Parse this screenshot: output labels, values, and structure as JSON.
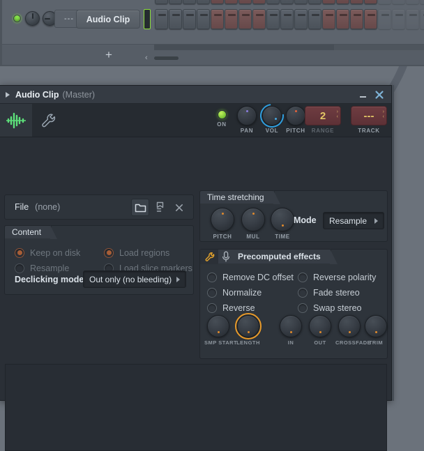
{
  "channel_rack": {
    "channel_name": "Audio Clip",
    "value_field": "---",
    "add_button": "+",
    "led_name": "channel-led",
    "steps_row_main": [
      "dark",
      "dark",
      "dark",
      "dark",
      "red",
      "red",
      "red",
      "red",
      "dark",
      "dark",
      "dark",
      "dark",
      "red",
      "red",
      "red",
      "red",
      "dim",
      "dim",
      "dim",
      "dim",
      "dim",
      "dim",
      "dim",
      "dim"
    ],
    "steps_row_top": [
      "dark",
      "dark",
      "dark",
      "dark",
      "red",
      "red",
      "red",
      "red",
      "dark",
      "dark",
      "dark",
      "dark",
      "red",
      "red",
      "red",
      "red",
      "dim",
      "dim",
      "dim",
      "dim",
      "dim",
      "dim",
      "dim",
      "dim"
    ]
  },
  "window": {
    "title": "Audio Clip",
    "subtitle": "(Master)",
    "minimize_icon": "minimize-icon",
    "close_icon": "close-icon",
    "expand_icon": "expand-arrow-icon"
  },
  "toolbar": {
    "waveform_tab_icon": "waveform-icon",
    "wrench_tab_icon": "wrench-icon"
  },
  "header_controls": [
    {
      "label": "ON",
      "type": "led",
      "name": "on-led"
    },
    {
      "label": "PAN",
      "type": "knob",
      "name": "pan-knob"
    },
    {
      "label": "VOL",
      "type": "knob",
      "name": "vol-knob"
    },
    {
      "label": "PITCH",
      "type": "knob",
      "name": "pitch-knob"
    },
    {
      "label": "RANGE",
      "type": "field",
      "name": "range-field",
      "value": "2"
    },
    {
      "label": "TRACK",
      "type": "field",
      "name": "track-field",
      "value": "---"
    }
  ],
  "file": {
    "label": "File",
    "value": "(none)",
    "open_icon": "folder-icon",
    "tag_icon": "bookmark-icon",
    "clear_icon": "close-x-icon"
  },
  "content": {
    "title": "Content",
    "options": [
      {
        "label": "Keep on disk",
        "checked": true
      },
      {
        "label": "Load regions",
        "checked": true
      },
      {
        "label": "Resample",
        "checked": false
      },
      {
        "label": "Load slice markers",
        "checked": false
      }
    ],
    "declicking_label": "Declicking mode",
    "declicking_value": "Out only (no bleeding)"
  },
  "time_stretching": {
    "title": "Time stretching",
    "knobs": [
      {
        "label": "PITCH"
      },
      {
        "label": "MUL"
      },
      {
        "label": "TIME"
      }
    ],
    "mode_label": "Mode",
    "mode_value": "Resample"
  },
  "precomputed_effects": {
    "title": "Precomputed effects",
    "wrench_icon": "wrench-icon",
    "mic_icon": "microphone-icon",
    "options": [
      {
        "label": "Remove DC offset",
        "checked": false
      },
      {
        "label": "Reverse polarity",
        "checked": false
      },
      {
        "label": "Normalize",
        "checked": false
      },
      {
        "label": "Fade stereo",
        "checked": false
      },
      {
        "label": "Reverse",
        "checked": false
      },
      {
        "label": "Swap stereo",
        "checked": false
      }
    ],
    "knobs": [
      {
        "label": "SMP START",
        "ringed": false
      },
      {
        "label": "LENGTH",
        "ringed": true
      },
      {
        "label": "IN",
        "ringed": false
      },
      {
        "label": "OUT",
        "ringed": false
      },
      {
        "label": "CROSSFADE",
        "ringed": false
      },
      {
        "label": "TRIM",
        "ringed": false
      }
    ]
  },
  "colors": {
    "accent_orange": "#e89a2a",
    "accent_blue": "#2f9fe0",
    "led_green": "#86e24a",
    "red_field": "#6f3c41",
    "yellow_text": "#e3c766",
    "panel_bg": "#2e343b",
    "window_bg": "#2a2f36"
  }
}
